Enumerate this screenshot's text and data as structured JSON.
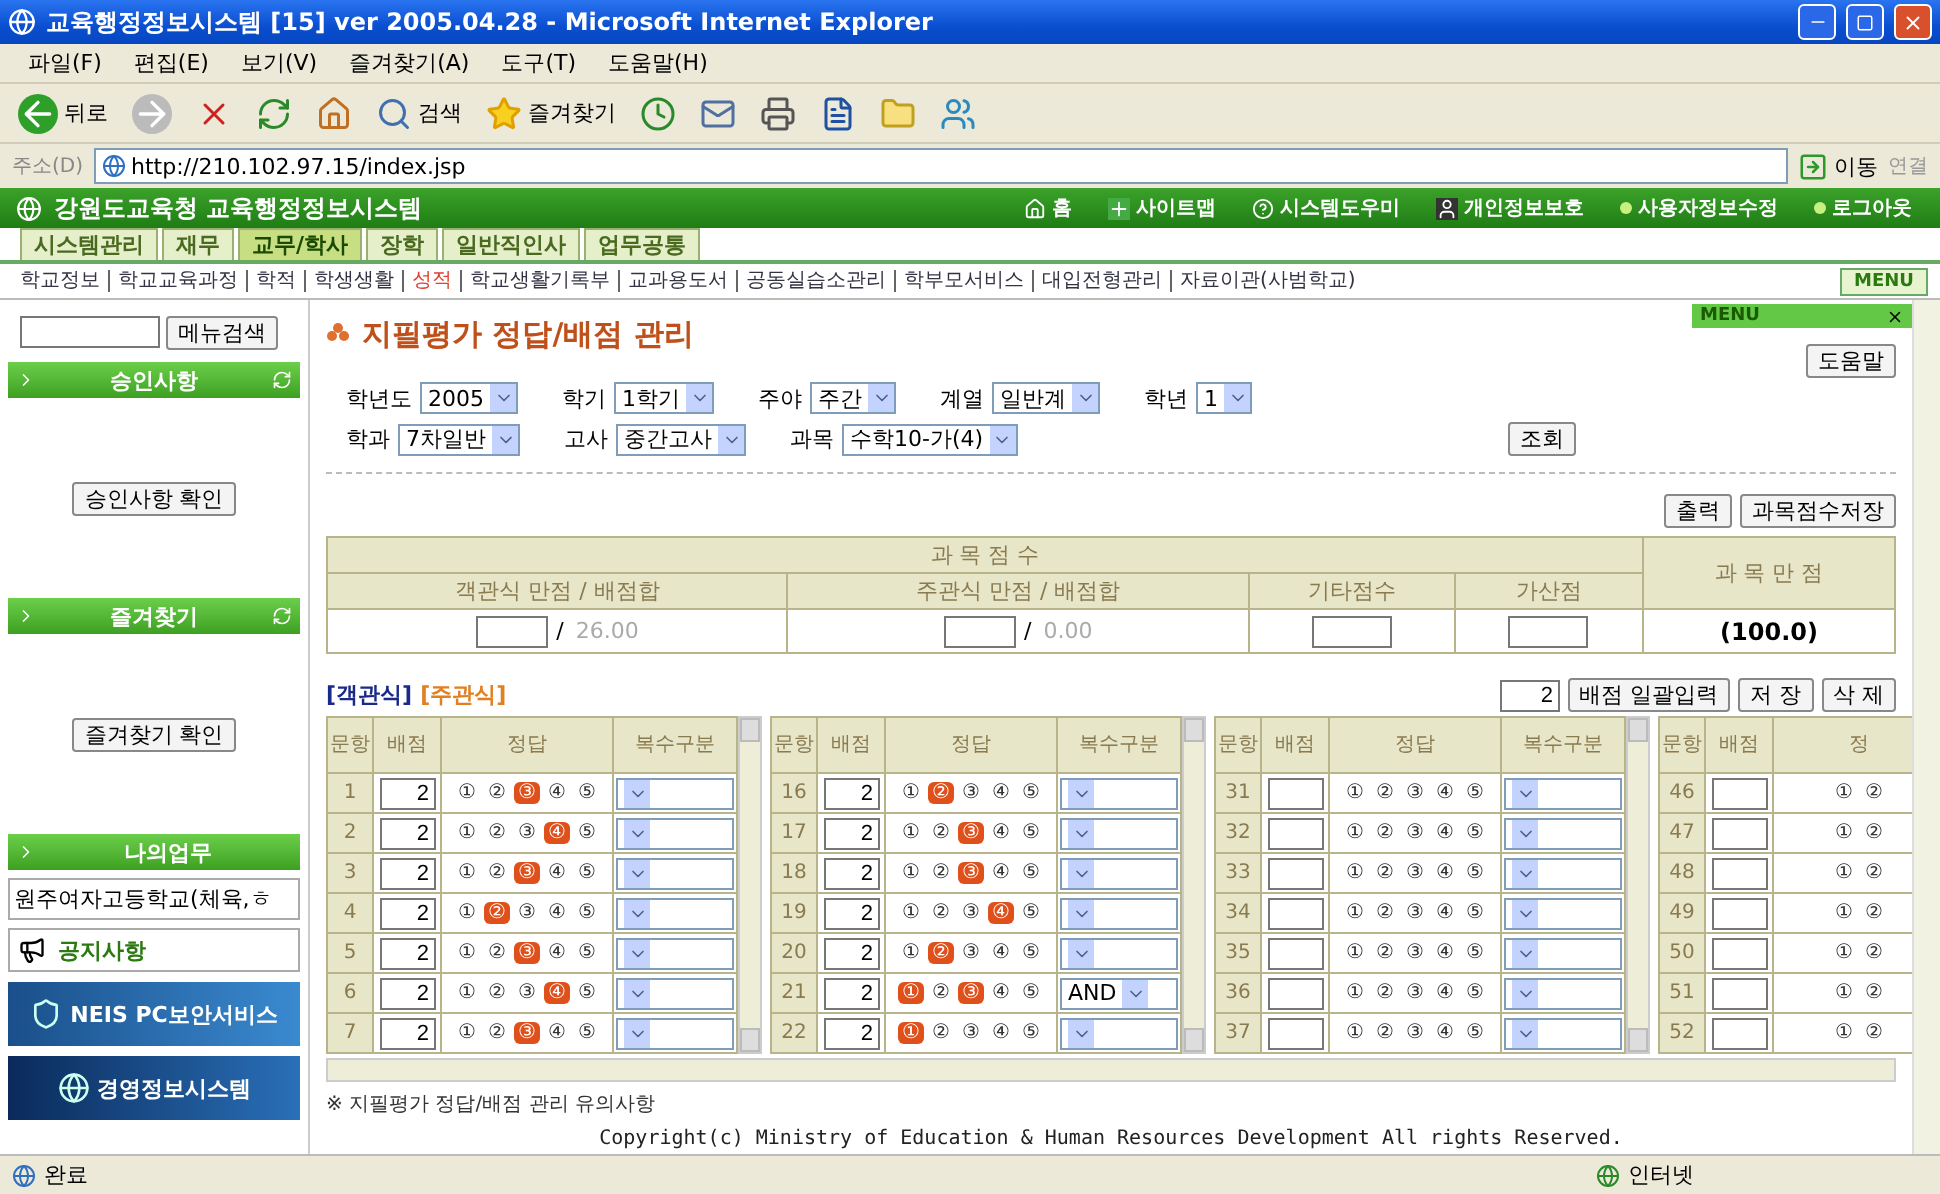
{
  "window": {
    "title": "교육행정정보시스템 [15] ver 2005.04.28 - Microsoft Internet Explorer"
  },
  "menu_bar": [
    "파일(F)",
    "편집(E)",
    "보기(V)",
    "즐겨찾기(A)",
    "도구(T)",
    "도움말(H)"
  ],
  "toolbar": [
    {
      "kind": "back",
      "label": "뒤로"
    },
    {
      "kind": "forward"
    },
    {
      "kind": "stop"
    },
    {
      "kind": "refresh"
    },
    {
      "kind": "home"
    },
    {
      "kind": "search",
      "label": "검색"
    },
    {
      "kind": "favorites",
      "label": "즐겨찾기"
    },
    {
      "kind": "history"
    },
    {
      "kind": "mail"
    },
    {
      "kind": "print"
    },
    {
      "kind": "word"
    },
    {
      "kind": "folder"
    },
    {
      "kind": "messenger"
    }
  ],
  "address_bar": {
    "label": "주소(D)",
    "value": "http://210.102.97.15/index.jsp",
    "go": "이동",
    "links": "연결"
  },
  "site_header": {
    "title": "강원도교육청 교육행정정보시스템",
    "links": [
      {
        "kind": "home",
        "label": "홈"
      },
      {
        "kind": "plus",
        "label": "사이트맵"
      },
      {
        "kind": "help",
        "label": "시스템도우미"
      },
      {
        "kind": "person",
        "label": "개인정보보호"
      },
      {
        "kind": "dot",
        "label": "사용자정보수정"
      },
      {
        "kind": "dot",
        "label": "로그아웃"
      }
    ]
  },
  "top_tabs": [
    {
      "label": "시스템관리",
      "selected": false
    },
    {
      "label": "재무",
      "selected": false
    },
    {
      "label": "교무/학사",
      "selected": true
    },
    {
      "label": "장학",
      "selected": false
    },
    {
      "label": "일반직인사",
      "selected": false
    },
    {
      "label": "업무공통",
      "selected": false
    }
  ],
  "sub_menu": {
    "items": [
      {
        "label": "학교정보",
        "selected": false
      },
      {
        "label": "학교교육과정",
        "selected": false
      },
      {
        "label": "학적",
        "selected": false
      },
      {
        "label": "학생생활",
        "selected": false
      },
      {
        "label": "성적",
        "selected": true
      },
      {
        "label": "학교생활기록부",
        "selected": false
      },
      {
        "label": "교과용도서",
        "selected": false
      },
      {
        "label": "공동실습소관리",
        "selected": false
      },
      {
        "label": "학부모서비스",
        "selected": false
      },
      {
        "label": "대입전형관리",
        "selected": false
      },
      {
        "label": "자료이관(사범학교)",
        "selected": false
      }
    ],
    "menu_button": "MENU"
  },
  "sidebar": {
    "search_button": "메뉴검색",
    "sections": [
      {
        "title": "승인사항",
        "button": "승인사항 확인"
      },
      {
        "title": "즐겨찾기",
        "button": "즐겨찾기 확인"
      }
    ],
    "my_work": {
      "title": "나의업무",
      "item": "원주여자고등학교(체육,ㅎ"
    },
    "notice": "공지사항",
    "banners": [
      {
        "kind": "security",
        "label": "NEIS PC보안서비스"
      },
      {
        "kind": "management",
        "label": "경영정보시스템"
      }
    ]
  },
  "main": {
    "title": "지필평가 정답/배점 관리",
    "menu_panel": "MENU",
    "help_button": "도움말",
    "filters": [
      [
        {
          "label": "학년도",
          "value": "2005"
        },
        {
          "label": "학기",
          "value": "1학기"
        },
        {
          "label": "주야",
          "value": "주간"
        },
        {
          "label": "계열",
          "value": "일반계"
        },
        {
          "label": "학년",
          "value": "1"
        }
      ],
      [
        {
          "label": "학과",
          "value": "7차일반"
        },
        {
          "label": "고사",
          "value": "중간고사"
        },
        {
          "label": "과목",
          "value": "수학10-가(4)"
        }
      ]
    ],
    "search_button": "조회",
    "actions": [
      "출력",
      "과목점수저장"
    ],
    "score_table": {
      "group": "과 목 점 수",
      "total_header": "과 목 만 점",
      "columns": [
        "객관식 만점 / 배점합",
        "주관식 만점 / 배점합",
        "기타점수",
        "가산점"
      ],
      "values": [
        {
          "kind": "input_sum",
          "separator": "/",
          "sum": "26.00"
        },
        {
          "kind": "input_sum",
          "separator": "/",
          "sum": "0.00"
        },
        {
          "kind": "input"
        },
        {
          "kind": "input"
        }
      ],
      "total": "(100.0)"
    },
    "answer_tabs": [
      {
        "label": "[객관식]",
        "selected": true
      },
      {
        "label": "[주관식]",
        "selected": false
      }
    ],
    "bulk": {
      "value": "2",
      "buttons": [
        "배점 일괄입력",
        "저 장",
        "삭 제"
      ]
    },
    "question_tables": [
      {
        "headers": [
          "문항",
          "배점",
          "정답",
          "복수구분"
        ],
        "rows": [
          {
            "number": "1",
            "points": "2",
            "options": [
              {
                "label": "①",
                "marked": false
              },
              {
                "label": "②",
                "marked": false
              },
              {
                "label": "③",
                "marked": true
              },
              {
                "label": "④",
                "marked": false
              },
              {
                "label": "⑤",
                "marked": false
              }
            ]
          },
          {
            "number": "2",
            "points": "2",
            "options": [
              {
                "label": "①",
                "marked": false
              },
              {
                "label": "②",
                "marked": false
              },
              {
                "label": "③",
                "marked": false
              },
              {
                "label": "④",
                "marked": true
              },
              {
                "label": "⑤",
                "marked": false
              }
            ]
          },
          {
            "number": "3",
            "points": "2",
            "options": [
              {
                "label": "①",
                "marked": false
              },
              {
                "label": "②",
                "marked": false
              },
              {
                "label": "③",
                "marked": true
              },
              {
                "label": "④",
                "marked": false
              },
              {
                "label": "⑤",
                "marked": false
              }
            ]
          },
          {
            "number": "4",
            "points": "2",
            "options": [
              {
                "label": "①",
                "marked": false
              },
              {
                "label": "②",
                "marked": true
              },
              {
                "label": "③",
                "marked": false
              },
              {
                "label": "④",
                "marked": false
              },
              {
                "label": "⑤",
                "marked": false
              }
            ]
          },
          {
            "number": "5",
            "points": "2",
            "options": [
              {
                "label": "①",
                "marked": false
              },
              {
                "label": "②",
                "marked": false
              },
              {
                "label": "③",
                "marked": true
              },
              {
                "label": "④",
                "marked": false
              },
              {
                "label": "⑤",
                "marked": false
              }
            ]
          },
          {
            "number": "6",
            "points": "2",
            "options": [
              {
                "label": "①",
                "marked": false
              },
              {
                "label": "②",
                "marked": false
              },
              {
                "label": "③",
                "marked": false
              },
              {
                "label": "④",
                "marked": true
              },
              {
                "label": "⑤",
                "marked": false
              }
            ]
          },
          {
            "number": "7",
            "points": "2",
            "options": [
              {
                "label": "①",
                "marked": false
              },
              {
                "label": "②",
                "marked": false
              },
              {
                "label": "③",
                "marked": true
              },
              {
                "label": "④",
                "marked": false
              },
              {
                "label": "⑤",
                "marked": false
              }
            ]
          }
        ]
      },
      {
        "headers": [
          "문항",
          "배점",
          "정답",
          "복수구분"
        ],
        "rows": [
          {
            "number": "16",
            "points": "2",
            "options": [
              {
                "label": "①",
                "marked": false
              },
              {
                "label": "②",
                "marked": true
              },
              {
                "label": "③",
                "marked": false
              },
              {
                "label": "④",
                "marked": false
              },
              {
                "label": "⑤",
                "marked": false
              }
            ]
          },
          {
            "number": "17",
            "points": "2",
            "options": [
              {
                "label": "①",
                "marked": false
              },
              {
                "label": "②",
                "marked": false
              },
              {
                "label": "③",
                "marked": true
              },
              {
                "label": "④",
                "marked": false
              },
              {
                "label": "⑤",
                "marked": false
              }
            ]
          },
          {
            "number": "18",
            "points": "2",
            "options": [
              {
                "label": "①",
                "marked": false
              },
              {
                "label": "②",
                "marked": false
              },
              {
                "label": "③",
                "marked": true
              },
              {
                "label": "④",
                "marked": false
              },
              {
                "label": "⑤",
                "marked": false
              }
            ]
          },
          {
            "number": "19",
            "points": "2",
            "options": [
              {
                "label": "①",
                "marked": false
              },
              {
                "label": "②",
                "marked": false
              },
              {
                "label": "③",
                "marked": false
              },
              {
                "label": "④",
                "marked": true
              },
              {
                "label": "⑤",
                "marked": false
              }
            ]
          },
          {
            "number": "20",
            "points": "2",
            "options": [
              {
                "label": "①",
                "marked": false
              },
              {
                "label": "②",
                "marked": true
              },
              {
                "label": "③",
                "marked": false
              },
              {
                "label": "④",
                "marked": false
              },
              {
                "label": "⑤",
                "marked": false
              }
            ]
          },
          {
            "number": "21",
            "points": "2",
            "multi": "AND",
            "options": [
              {
                "label": "①",
                "marked": true
              },
              {
                "label": "②",
                "marked": false
              },
              {
                "label": "③",
                "marked": true
              },
              {
                "label": "④",
                "marked": false
              },
              {
                "label": "⑤",
                "marked": false
              }
            ]
          },
          {
            "number": "22",
            "points": "2",
            "options": [
              {
                "label": "①",
                "marked": true
              },
              {
                "label": "②",
                "marked": false
              },
              {
                "label": "③",
                "marked": false
              },
              {
                "label": "④",
                "marked": false
              },
              {
                "label": "⑤",
                "marked": false
              }
            ]
          }
        ]
      },
      {
        "headers": [
          "문항",
          "배점",
          "정답",
          "복수구분"
        ],
        "rows": [
          {
            "number": "31",
            "options": [
              {
                "label": "①",
                "marked": false
              },
              {
                "label": "②",
                "marked": false
              },
              {
                "label": "③",
                "marked": false
              },
              {
                "label": "④",
                "marked": false
              },
              {
                "label": "⑤",
                "marked": false
              }
            ]
          },
          {
            "number": "32",
            "options": [
              {
                "label": "①",
                "marked": false
              },
              {
                "label": "②",
                "marked": false
              },
              {
                "label": "③",
                "marked": false
              },
              {
                "label": "④",
                "marked": false
              },
              {
                "label": "⑤",
                "marked": false
              }
            ]
          },
          {
            "number": "33",
            "options": [
              {
                "label": "①",
                "marked": false
              },
              {
                "label": "②",
                "marked": false
              },
              {
                "label": "③",
                "marked": false
              },
              {
                "label": "④",
                "marked": false
              },
              {
                "label": "⑤",
                "marked": false
              }
            ]
          },
          {
            "number": "34",
            "options": [
              {
                "label": "①",
                "marked": false
              },
              {
                "label": "②",
                "marked": false
              },
              {
                "label": "③",
                "marked": false
              },
              {
                "label": "④",
                "marked": false
              },
              {
                "label": "⑤",
                "marked": false
              }
            ]
          },
          {
            "number": "35",
            "options": [
              {
                "label": "①",
                "marked": false
              },
              {
                "label": "②",
                "marked": false
              },
              {
                "label": "③",
                "marked": false
              },
              {
                "label": "④",
                "marked": false
              },
              {
                "label": "⑤",
                "marked": false
              }
            ]
          },
          {
            "number": "36",
            "options": [
              {
                "label": "①",
                "marked": false
              },
              {
                "label": "②",
                "marked": false
              },
              {
                "label": "③",
                "marked": false
              },
              {
                "label": "④",
                "marked": false
              },
              {
                "label": "⑤",
                "marked": false
              }
            ]
          },
          {
            "number": "37",
            "options": [
              {
                "label": "①",
                "marked": false
              },
              {
                "label": "②",
                "marked": false
              },
              {
                "label": "③",
                "marked": false
              },
              {
                "label": "④",
                "marked": false
              },
              {
                "label": "⑤",
                "marked": false
              }
            ]
          }
        ]
      },
      {
        "headers": [
          "문항",
          "배점",
          "정"
        ],
        "rows": [
          {
            "number": "46",
            "options": [
              {
                "label": "①",
                "marked": false
              },
              {
                "label": "②",
                "marked": false
              }
            ]
          },
          {
            "number": "47",
            "options": [
              {
                "label": "①",
                "marked": false
              },
              {
                "label": "②",
                "marked": false
              }
            ]
          },
          {
            "number": "48",
            "options": [
              {
                "label": "①",
                "marked": false
              },
              {
                "label": "②",
                "marked": false
              }
            ]
          },
          {
            "number": "49",
            "options": [
              {
                "label": "①",
                "marked": false
              },
              {
                "label": "②",
                "marked": false
              }
            ]
          },
          {
            "number": "50",
            "options": [
              {
                "label": "①",
                "marked": false
              },
              {
                "label": "②",
                "marked": false
              }
            ]
          },
          {
            "number": "51",
            "options": [
              {
                "label": "①",
                "marked": false
              },
              {
                "label": "②",
                "marked": false
              }
            ]
          },
          {
            "number": "52",
            "options": [
              {
                "label": "①",
                "marked": false
              },
              {
                "label": "②",
                "marked": false
              }
            ]
          }
        ]
      }
    ],
    "notes": [
      "※ 지필평가 정답/배점 관리 유의사항"
    ],
    "copyright": "Copyright(c) Ministry of Education & Human Resources Development All rights Reserved."
  },
  "status_bar": {
    "text": "완료",
    "zone": "인터넷"
  }
}
